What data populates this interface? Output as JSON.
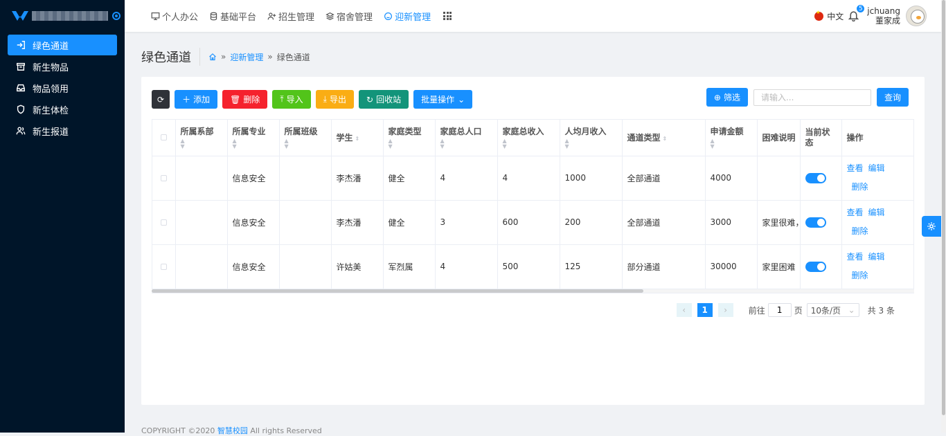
{
  "sidebar": {
    "items": [
      {
        "label": "绿色通道",
        "icon": "enter-icon",
        "active": true
      },
      {
        "label": "新生物品",
        "icon": "box-icon",
        "active": false
      },
      {
        "label": "物品领用",
        "icon": "inbox-icon",
        "active": false
      },
      {
        "label": "新生体检",
        "icon": "shield-icon",
        "active": false
      },
      {
        "label": "新生报道",
        "icon": "users-icon",
        "active": false
      }
    ]
  },
  "topnav": {
    "items": [
      {
        "label": "个人办公",
        "icon": "desktop-icon"
      },
      {
        "label": "基础平台",
        "icon": "database-icon"
      },
      {
        "label": "招生管理",
        "icon": "user-add-icon"
      },
      {
        "label": "宿舍管理",
        "icon": "layers-icon"
      },
      {
        "label": "迎新管理",
        "icon": "smile-icon"
      }
    ],
    "active_index": 4
  },
  "header": {
    "lang": "中文",
    "notifications": "5",
    "username": "jchuang",
    "realname": "董家成"
  },
  "page": {
    "title": "绿色通道",
    "breadcrumb_parent": "迎新管理",
    "breadcrumb_current": "绿色通道",
    "sep": "»"
  },
  "toolbar": {
    "add": "添加",
    "delete": "删除",
    "import": "导入",
    "export": "导出",
    "recycle": "回收站",
    "batch": "批量操作",
    "filter": "筛选",
    "search_placeholder": "请输入...",
    "query": "查询"
  },
  "table": {
    "headers": [
      "所属系部",
      "所属专业",
      "所属班级",
      "学生",
      "家庭类型",
      "家庭总人口",
      "家庭总收入",
      "人均月收入",
      "通道类型",
      "申请金额",
      "困难说明",
      "当前状态",
      "操作"
    ],
    "rows": [
      {
        "dept": "",
        "major": "信息安全",
        "class": "",
        "student": "李杰潘",
        "family_type": "健全",
        "population": "4",
        "income": "4",
        "monthly": "1000",
        "channel": "全部通道",
        "amount": "4000",
        "reason": "",
        "status": true
      },
      {
        "dept": "",
        "major": "信息安全",
        "class": "",
        "student": "李杰潘",
        "family_type": "健全",
        "population": "3",
        "income": "600",
        "monthly": "200",
        "channel": "全部通道",
        "amount": "3000",
        "reason": "家里很难，",
        "status": true
      },
      {
        "dept": "",
        "major": "信息安全",
        "class": "",
        "student": "许姑美",
        "family_type": "军烈属",
        "population": "4",
        "income": "500",
        "monthly": "125",
        "channel": "部分通道",
        "amount": "30000",
        "reason": "家里困难",
        "status": true
      }
    ],
    "ops": {
      "view": "查看",
      "edit": "编辑",
      "delete": "删除"
    }
  },
  "pagination": {
    "current": "1",
    "goto_prefix": "前往",
    "goto_value": "1",
    "goto_suffix": "页",
    "page_size": "10条/页",
    "total": "共 3 条"
  },
  "footer": {
    "text_pre": "COPYRIGHT ©2020",
    "link": "智慧校园",
    "text_post": "All rights Reserved"
  }
}
